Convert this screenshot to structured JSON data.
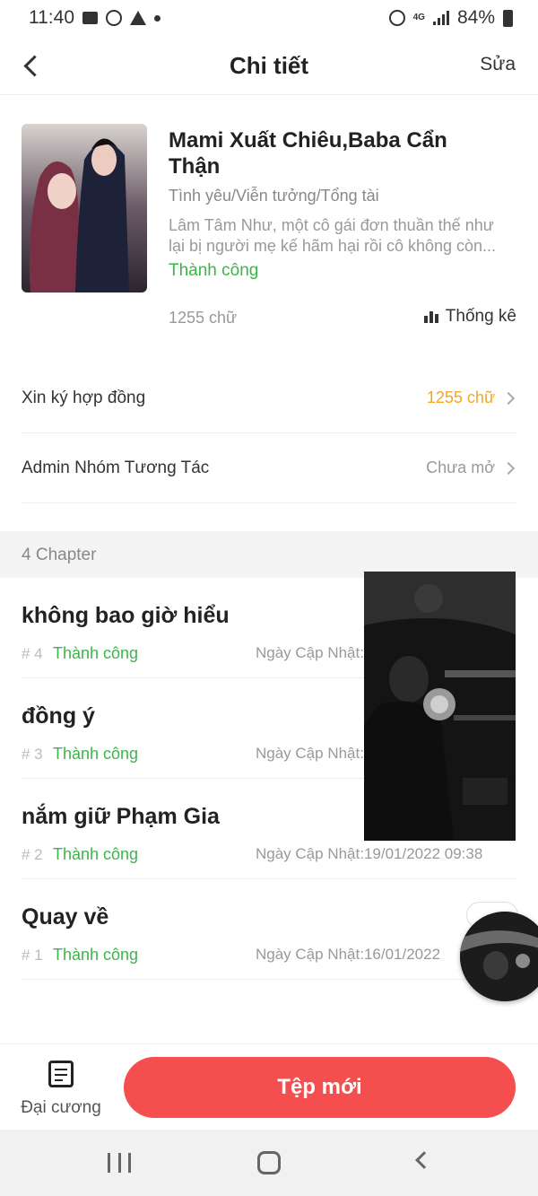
{
  "status_bar": {
    "time": "11:40",
    "battery": "84%",
    "network": "4G",
    "left_icons": [
      "image-icon",
      "messenger-icon",
      "warning-icon",
      "dot-icon"
    ],
    "right_icons": [
      "alarm-icon",
      "4g-icon",
      "signal-icon",
      "battery-icon"
    ]
  },
  "header": {
    "title": "Chi tiết",
    "edit_label": "Sửa",
    "back_icon": "back-arrow-icon"
  },
  "book": {
    "title": "Mami Xuất Chiêu,Baba Cẩn Thận",
    "genre": "Tình yêu/Viễn tưởng/Tổng tài",
    "description_line1": "Lâm Tâm Như, một cô gái đơn thuần thế như",
    "description_line2": "lại bị người mẹ kế hãm hại rồi cô không còn...",
    "status": "Thành công",
    "word_count": "1255 chữ",
    "stats_label": "Thống kê"
  },
  "rows": [
    {
      "label": "Xin ký hợp đồng",
      "value": "1255 chữ",
      "value_color": "#f5a623"
    },
    {
      "label": "Admin Nhóm Tương Tác",
      "value": "Chưa mở",
      "value_color": "#999999"
    }
  ],
  "chapters_header": "4 Chapter",
  "chapters": [
    {
      "title": "không bao giờ hiểu",
      "number": "# 4",
      "status": "Thành công",
      "date": "Ngày Cập Nhật:"
    },
    {
      "title": "đồng ý",
      "number": "# 3",
      "status": "Thành công",
      "date": "Ngày Cập Nhật:"
    },
    {
      "title": "nắm giữ Phạm Gia",
      "number": "# 2",
      "status": "Thành công",
      "date": "Ngày Cập Nhật:19/01/2022 09:38"
    },
    {
      "title": "Quay về",
      "number": "# 1",
      "status": "Thành công",
      "date": "Ngày Cập Nhật:16/01/2022"
    }
  ],
  "bottom_bar": {
    "outline_label": "Đại cương",
    "new_file_label": "Tệp mới"
  },
  "colors": {
    "accent_red": "#f44e4e",
    "success_green": "#3bb54a",
    "highlight_orange": "#f5a623"
  }
}
